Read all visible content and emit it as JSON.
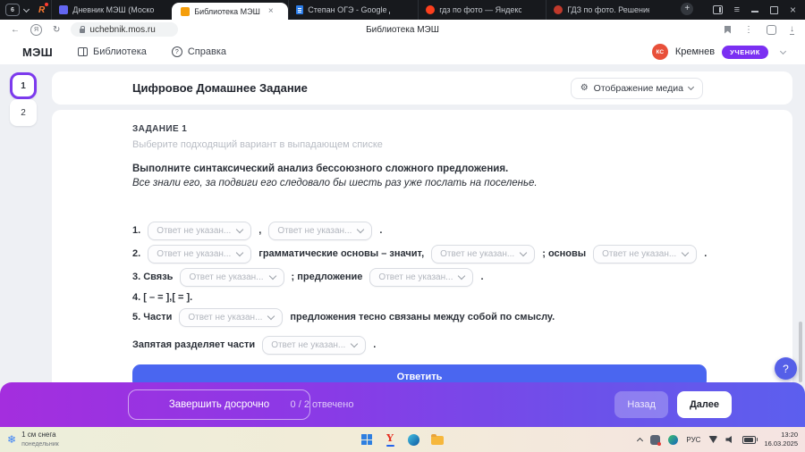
{
  "browser": {
    "tab_counter": "6",
    "pinned_tab": "R",
    "tabs": [
      {
        "title": "Дневник МЭШ (Москово"
      },
      {
        "title": "Библиотека МЭШ"
      },
      {
        "title": "Степан ОГЭ - Google До"
      },
      {
        "title": "гдз по фото — Яндекс:на"
      },
      {
        "title": "ГДЗ по фото. Решение п"
      }
    ],
    "url": "uchebnik.mos.ru",
    "page_title": "Библиотека МЭШ"
  },
  "app_header": {
    "logo": "МЭШ",
    "nav_library": "Библиотека",
    "nav_help": "Справка",
    "user_initials": "КС",
    "user_name": "Кремнев",
    "role_badge": "УЧЕНИК"
  },
  "page_nav": {
    "page1": "1",
    "page2": "2"
  },
  "content": {
    "title": "Цифровое Домашнее Задание",
    "media_button": "Отображение медиа",
    "task_label": "ЗАДАНИЕ 1",
    "task_hint": "Выберите подходящий вариант в выпадающем списке",
    "instruction": "Выполните синтаксический анализ бессоюзного сложного предложения.",
    "sentence": "Все знали его, за подвиги его следовало бы шесть раз уже послать на поселенье.",
    "dropdown_placeholder": "Ответ не указан...",
    "rows": [
      {
        "t0": "1.",
        "t1": ",",
        "t2": "."
      },
      {
        "t0": "2.",
        "t1": "грамматические основы – значит,",
        "t2": "; основы",
        "t3": "."
      },
      {
        "t0": "3. Связь",
        "t1": "; предложение",
        "t2": "."
      },
      {
        "t0": "4. [ – = ],[ = ]."
      },
      {
        "t0": "5. Части",
        "t1": "предложения тесно связаны между собой по смыслу."
      },
      {
        "t0": "Запятая разделяет части",
        "t1": "."
      }
    ],
    "submit": "Ответить"
  },
  "footer": {
    "finish_early": "Завершить досрочно",
    "progress": "0 / 2 отвечено",
    "back": "Назад",
    "next": "Далее"
  },
  "taskbar": {
    "weather_line1": "1 см снега",
    "weather_line2": "понедельник",
    "lang": "РУС",
    "time": "13:20",
    "date": "16.03.2025"
  },
  "icons": {
    "back": "←",
    "refresh": "↻",
    "yandex_letter": "Я",
    "kebab": "⋮",
    "download": "↓",
    "menu": "≡",
    "close": "×",
    "new_tab": "+",
    "gear": "⚙",
    "question": "?",
    "snowflake": "❄",
    "yandex_y": "Y"
  },
  "colors": {
    "accent_purple": "#7c3aed",
    "accent_blue": "#4a66f0",
    "badge_purple": "#7b2ff2",
    "avatar_red": "#e8503a"
  }
}
